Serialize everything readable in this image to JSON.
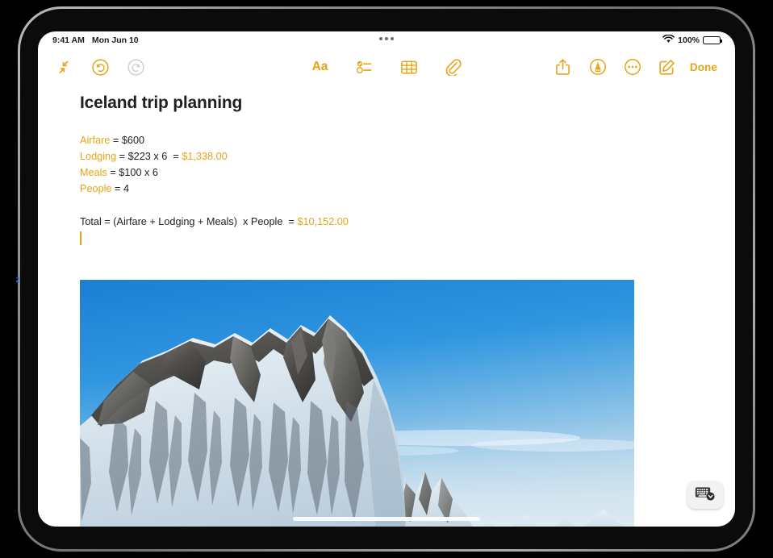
{
  "device": {
    "callout_marker": "2"
  },
  "status_bar": {
    "time": "9:41 AM",
    "date": "Mon Jun 10",
    "wifi_icon": "wifi-icon",
    "battery_percent": "100%",
    "battery_icon": "battery-full-icon",
    "multitask_handle_icon": "multitasking-handle-icon"
  },
  "toolbar": {
    "left": [
      {
        "name": "collapse-icon",
        "label": "Collapse"
      },
      {
        "name": "undo-icon",
        "label": "Undo"
      },
      {
        "name": "redo-icon",
        "label": "Redo"
      }
    ],
    "center": [
      {
        "name": "format-text-icon",
        "label": "Aa"
      },
      {
        "name": "checklist-icon",
        "label": "Checklist"
      },
      {
        "name": "table-icon",
        "label": "Table"
      },
      {
        "name": "attachment-icon",
        "label": "Attachment"
      }
    ],
    "right": [
      {
        "name": "share-icon",
        "label": "Share"
      },
      {
        "name": "markup-icon",
        "label": "Markup"
      },
      {
        "name": "more-icon",
        "label": "More"
      },
      {
        "name": "compose-icon",
        "label": "New Note"
      }
    ],
    "done_label": "Done"
  },
  "note": {
    "title": "Iceland trip planning",
    "lines": [
      {
        "var": "Airfare",
        "expr": " = $600",
        "result": ""
      },
      {
        "var": "Lodging",
        "expr": " = $223 x 6  = ",
        "result": "$1,338.00"
      },
      {
        "var": "Meals",
        "expr": " = $100 x 6",
        "result": ""
      },
      {
        "var": "People",
        "expr": " = 4",
        "result": ""
      }
    ],
    "total": {
      "expression": "Total = (Airfare + Lodging + Meals)  x People  = ",
      "result": "$10,152.00"
    },
    "photo_alt": "Snow-covered mountain peaks under a clear blue sky in Iceland"
  },
  "keyboard_dismiss": {
    "icon": "hide-keyboard-icon",
    "label": "Hide Keyboard"
  },
  "colors": {
    "accent_orange": "#E8A317",
    "text_dark": "#1f1f20",
    "disabled_gray": "#cfcfd2",
    "sky_blue": "#2f96e0"
  }
}
